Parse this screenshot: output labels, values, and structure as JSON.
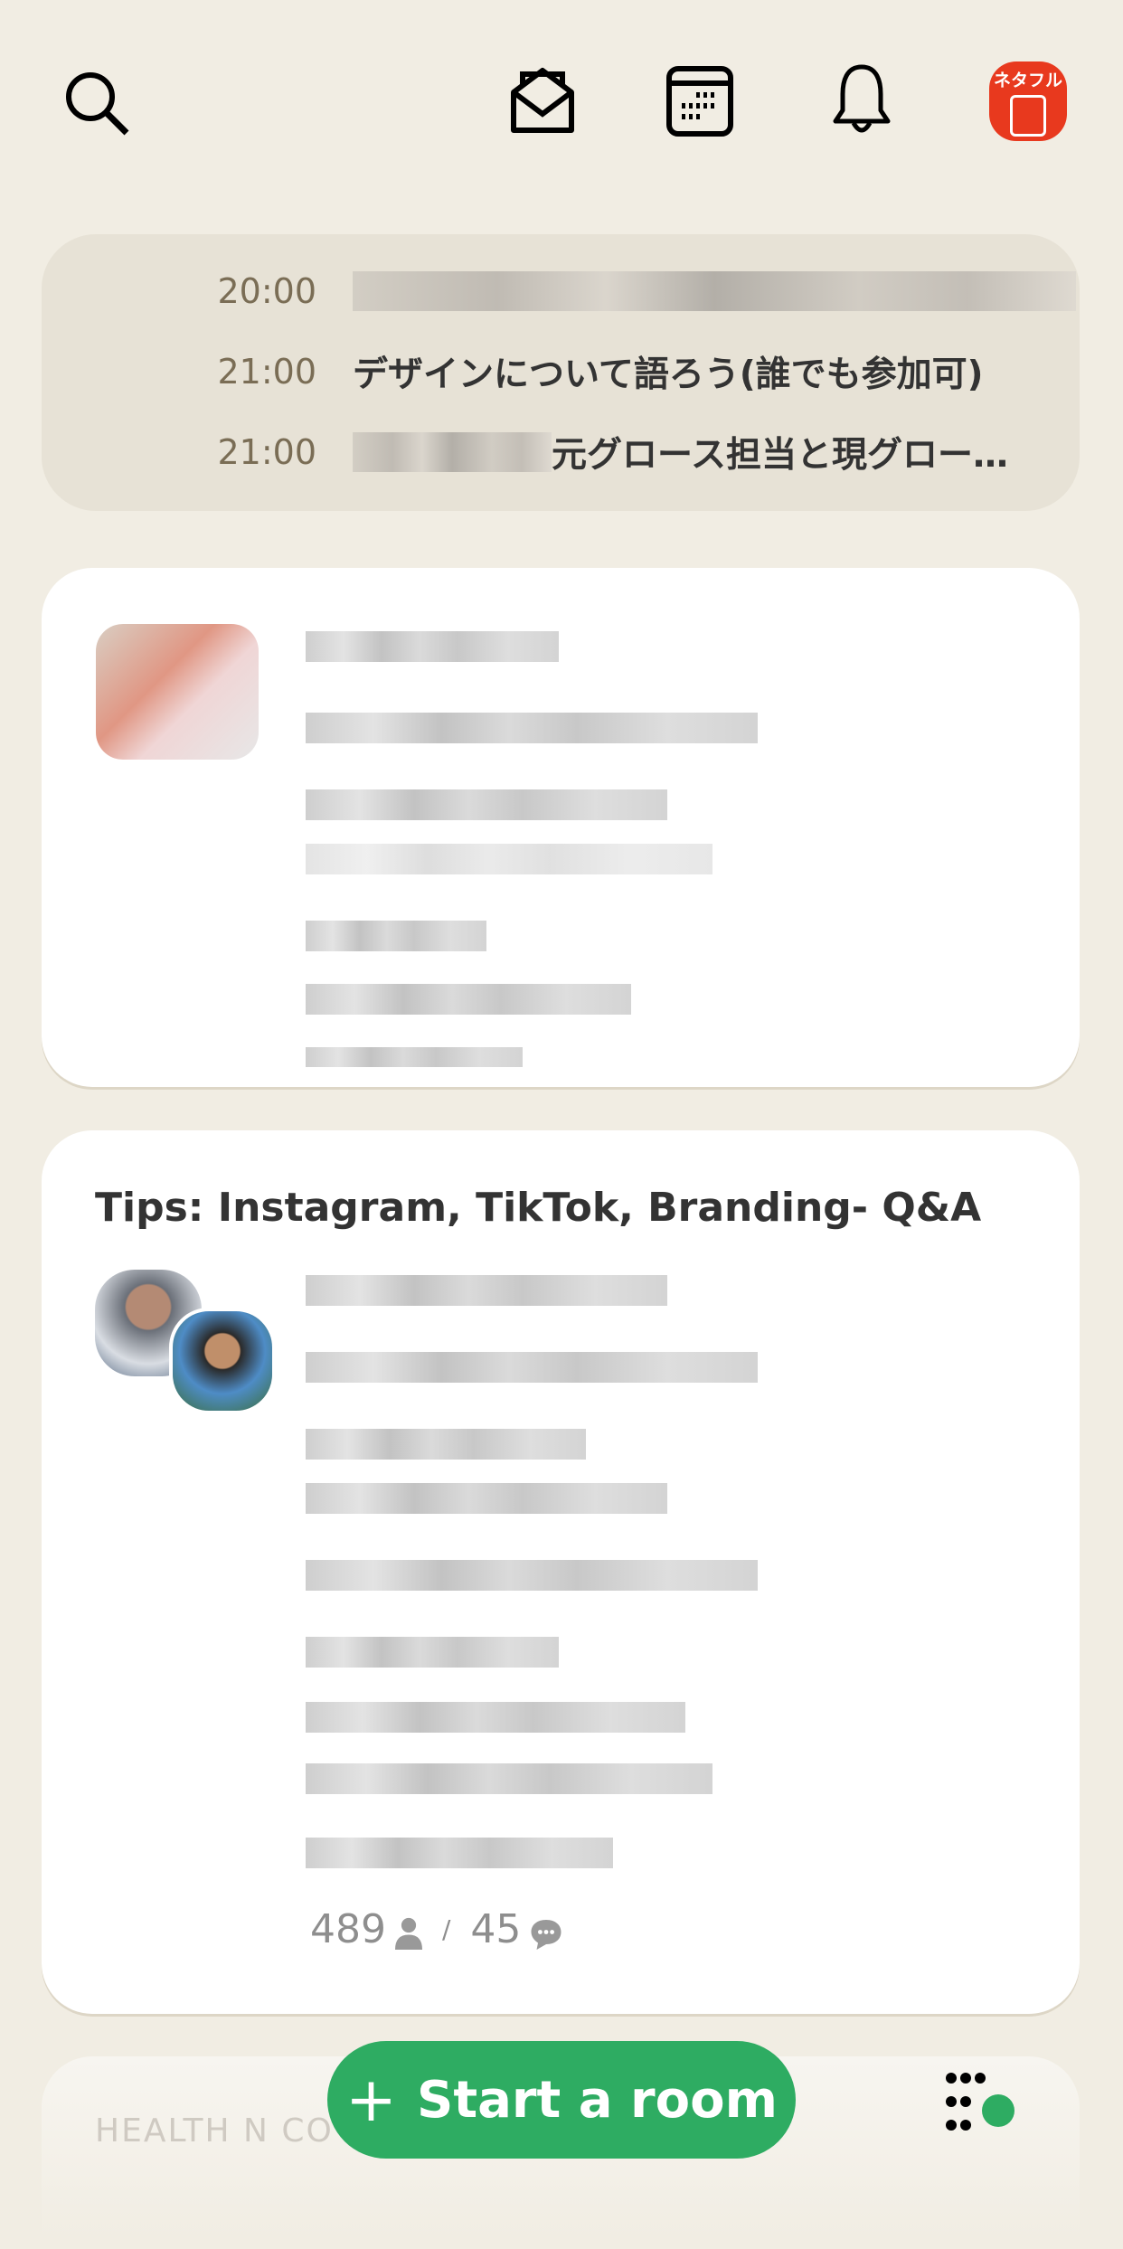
{
  "header": {
    "icons": [
      "search-icon",
      "envelope-open-icon",
      "calendar-icon",
      "bell-icon",
      "profile-avatar"
    ],
    "avatar_text": "ネタフル",
    "avatar_color": "#e8391e"
  },
  "schedule": [
    {
      "time": "20:00",
      "title": "",
      "redacted": true
    },
    {
      "time": "21:00",
      "title": "デザインについて語ろう(誰でも参加可)"
    },
    {
      "time": "21:00",
      "title": "元グロース担当と現グロー…",
      "redacted_prefix": true
    }
  ],
  "rooms": [
    {
      "title": "",
      "redacted": true
    },
    {
      "title": "Tips: Instagram, TikTok, Branding- Q&A",
      "listeners": "489",
      "separator": "/",
      "speakers": "45"
    }
  ],
  "next_room": {
    "club": "HEALTH N CO"
  },
  "footer": {
    "start_room_label": "Start a room",
    "plus": "+",
    "accent": "#2eac62"
  }
}
